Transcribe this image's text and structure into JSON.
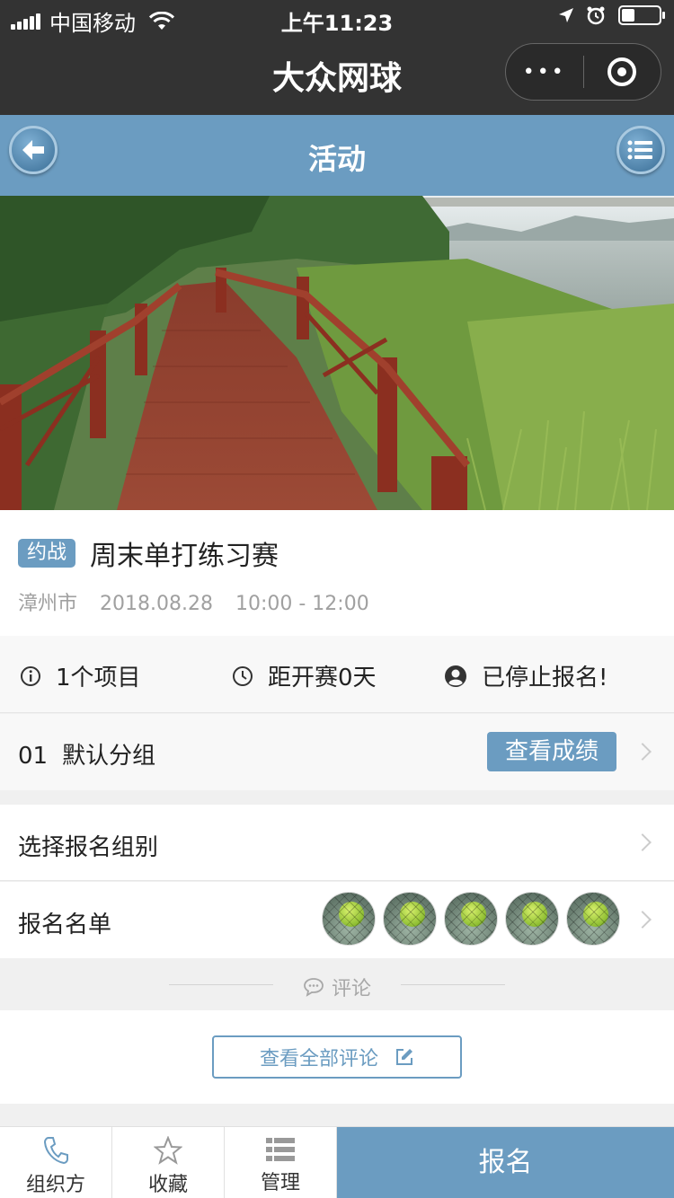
{
  "status_bar": {
    "carrier": "中国移动",
    "time": "上午11:23"
  },
  "nav": {
    "title": "大众网球",
    "more_label": "•••"
  },
  "header": {
    "title": "活动"
  },
  "event": {
    "badge": "约战",
    "title": "周末单打练习赛",
    "city": "漳州市",
    "date": "2018.08.28",
    "time_range": "10:00 - 12:00"
  },
  "stats": {
    "items": "1个项目",
    "countdown": "距开赛0天",
    "status": "已停止报名!"
  },
  "group": {
    "number": "01",
    "name": "默认分组",
    "results_label": "查看成绩"
  },
  "rows": {
    "select_group": "选择报名组别",
    "signup_list": "报名名单"
  },
  "comments": {
    "section_title": "评论",
    "view_all": "查看全部评论"
  },
  "bottom_bar": {
    "organizer": "组织方",
    "favorite": "收藏",
    "manage": "管理",
    "signup": "报名"
  },
  "icons": {
    "back": "back-arrow-icon",
    "menu": "list-icon",
    "info": "info-icon",
    "clock": "clock-icon",
    "user": "user-icon",
    "comment": "comment-icon",
    "edit": "edit-icon",
    "phone": "phone-icon",
    "star": "star-icon",
    "manage": "manage-list-icon"
  },
  "colors": {
    "accent": "#6b9cc1",
    "nav_bg": "#333333"
  }
}
